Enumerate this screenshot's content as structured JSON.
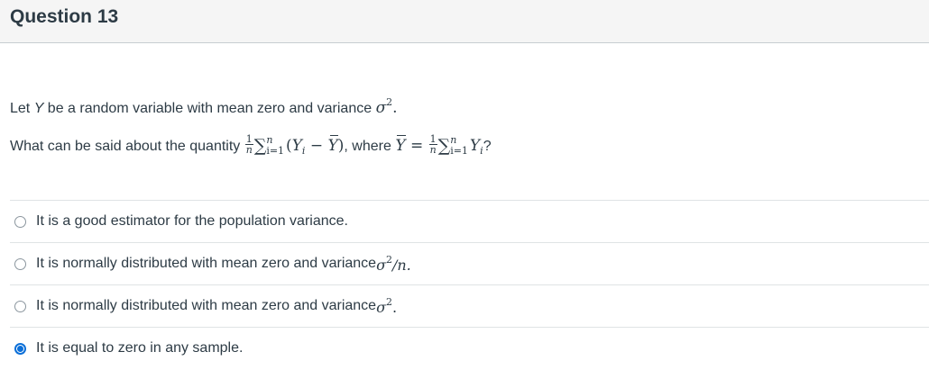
{
  "header": {
    "title": "Question 13"
  },
  "question": {
    "line1_prefix": "Let ",
    "line1_var": "Y",
    "line1_mid": " be a random variable with mean zero and variance ",
    "line1_sigma": "σ",
    "line1_exp": "2",
    "line1_end": ".",
    "line2_prefix": "What can be said about the quantity ",
    "frac_num": "1",
    "frac_den": "n",
    "sum_symbol": "∑",
    "sum_upper": "n",
    "sum_lower": "i=1",
    "expr_open": "(",
    "expr_Y": "Y",
    "expr_i": "i",
    "expr_minus": " − ",
    "expr_Ybar": "Y",
    "expr_close": ")",
    "line2_where": ", where ",
    "where_Ybar": "Y",
    "where_eq": " = ",
    "where_Y": "Y",
    "where_i": "i",
    "line2_end": "?"
  },
  "answers": [
    {
      "text": "It is a good estimator for the population variance.",
      "math": "",
      "selected": false
    },
    {
      "text": "It is normally distributed with mean zero and variance ",
      "math_sigma": "σ",
      "math_exp": "2",
      "math_tail": "/n.",
      "selected": false
    },
    {
      "text": "It is normally distributed with mean zero and variance ",
      "math_sigma": "σ",
      "math_exp": "2",
      "math_tail": ".",
      "selected": false
    },
    {
      "text": "It is equal to zero in any sample.",
      "math": "",
      "selected": true
    }
  ],
  "colors": {
    "accent": "#0b6fd8",
    "text": "#2d3b45",
    "divider": "#dfe3e5"
  }
}
